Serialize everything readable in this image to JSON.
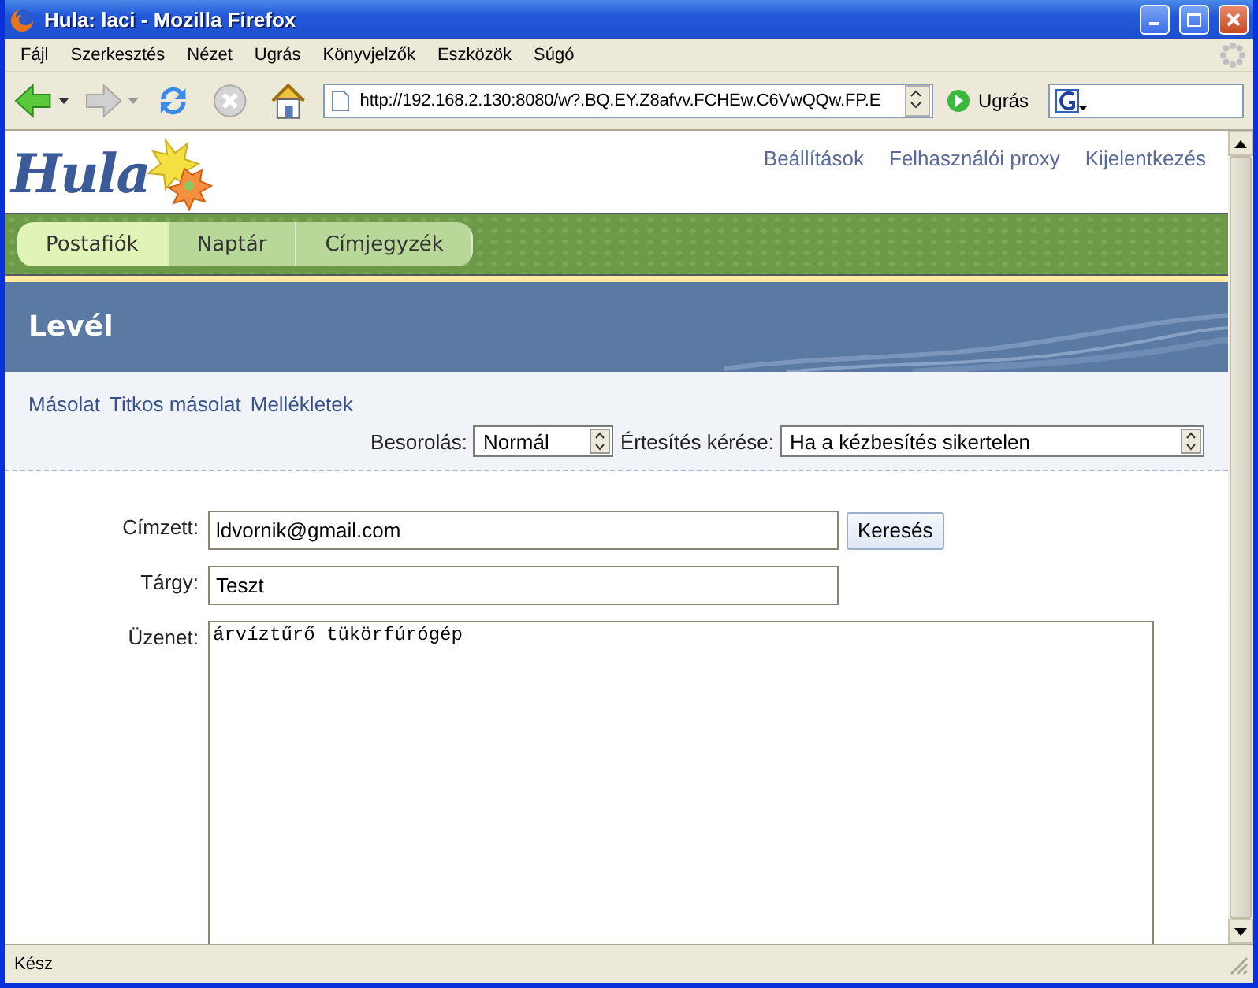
{
  "window": {
    "title": "Hula: laci - Mozilla Firefox"
  },
  "menu": [
    "Fájl",
    "Szerkesztés",
    "Nézet",
    "Ugrás",
    "Könyvjelzők",
    "Eszközök",
    "Súgó"
  ],
  "toolbar": {
    "url": "http://192.168.2.130:8080/w?.BQ.EY.Z8afvv.FCHEw.C6VwQQw.FP.E",
    "go_label": "Ugrás"
  },
  "app": {
    "logo": "Hula",
    "header_links": [
      "Beállítások",
      "Felhasználói proxy",
      "Kijelentkezés"
    ],
    "tabs": [
      {
        "label": "Postafiók",
        "selected": true
      },
      {
        "label": "Naptár",
        "selected": false
      },
      {
        "label": "Címjegyzék",
        "selected": false
      }
    ],
    "page_title": "Levél",
    "option_links": [
      "Másolat",
      "Titkos másolat",
      "Mellékletek"
    ],
    "priority": {
      "label": "Besorolás:",
      "value": "Normál"
    },
    "notify": {
      "label": "Értesítés kérése:",
      "value": "Ha a kézbesítés sikertelen"
    },
    "form": {
      "to": {
        "label": "Címzett:",
        "value": "ldvornik@gmail.com"
      },
      "search_button": "Keresés",
      "subject": {
        "label": "Tárgy:",
        "value": "Teszt"
      },
      "message": {
        "label": "Üzenet:",
        "value": "árvíztűrő tükörfúrógép"
      }
    }
  },
  "status_bar": "Kész"
}
